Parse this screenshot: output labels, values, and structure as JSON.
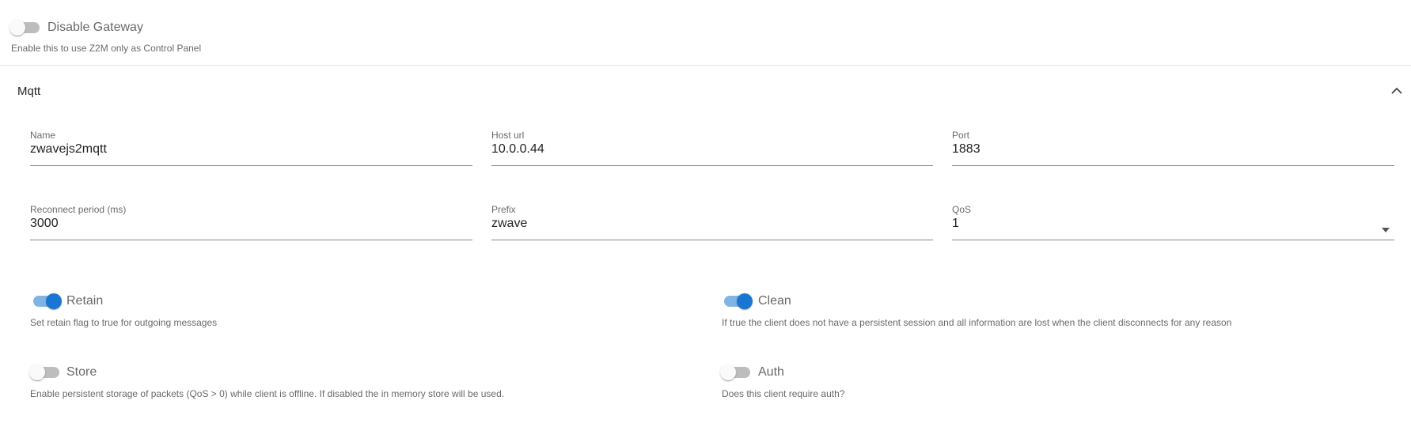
{
  "gateway": {
    "disable_label": "Disable Gateway",
    "disable_hint": "Enable this to use Z2M only as Control Panel",
    "disable_on": false
  },
  "mqtt": {
    "title": "Mqtt",
    "fields": {
      "name": {
        "label": "Name",
        "value": "zwavejs2mqtt"
      },
      "host": {
        "label": "Host url",
        "value": "10.0.0.44"
      },
      "port": {
        "label": "Port",
        "value": "1883"
      },
      "reconnect": {
        "label": "Reconnect period (ms)",
        "value": "3000"
      },
      "prefix": {
        "label": "Prefix",
        "value": "zwave"
      },
      "qos": {
        "label": "QoS",
        "value": "1"
      }
    },
    "switches": {
      "retain": {
        "label": "Retain",
        "hint": "Set retain flag to true for outgoing messages",
        "on": true
      },
      "clean": {
        "label": "Clean",
        "hint": "If true the client does not have a persistent session and all information are lost when the client disconnects for any reason",
        "on": true
      },
      "store": {
        "label": "Store",
        "hint": "Enable persistent storage of packets (QoS > 0) while client is offline. If disabled the in memory store will be used.",
        "on": false
      },
      "auth": {
        "label": "Auth",
        "hint": "Does this client require auth?",
        "on": false
      }
    }
  },
  "colors": {
    "accent": "#1976d2",
    "track_off": "#bdbdbd",
    "divider": "#e0e0e0"
  },
  "icons": {
    "collapse": "chevron-up-icon",
    "dropdown": "dropdown-arrow-icon"
  }
}
